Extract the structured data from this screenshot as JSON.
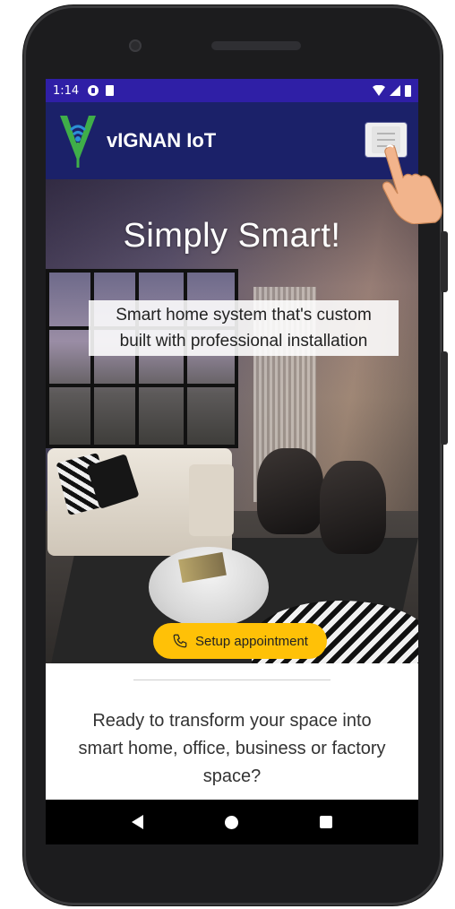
{
  "status_bar": {
    "time": "1:14"
  },
  "navbar": {
    "brand": "vIGNAN IoT"
  },
  "hero": {
    "title": "Simply Smart!",
    "subtitle_line1": "Smart home system that's custom",
    "subtitle_line2": "built with professional installation",
    "cta_label": "Setup appointment"
  },
  "intro": {
    "line1": "Ready to transform your space into",
    "line2": "smart home, office, business or factory",
    "line3": "space?"
  },
  "icons": {
    "menu": "hamburger-menu-icon",
    "cta": "phone-icon",
    "nav_back": "back-triangle-icon",
    "nav_home": "home-circle-icon",
    "nav_recent": "recent-apps-square-icon"
  },
  "colors": {
    "status_bar": "#2f1fa6",
    "navbar": "#1b2169",
    "cta": "#ffc107",
    "logo_green": "#3fae49"
  }
}
